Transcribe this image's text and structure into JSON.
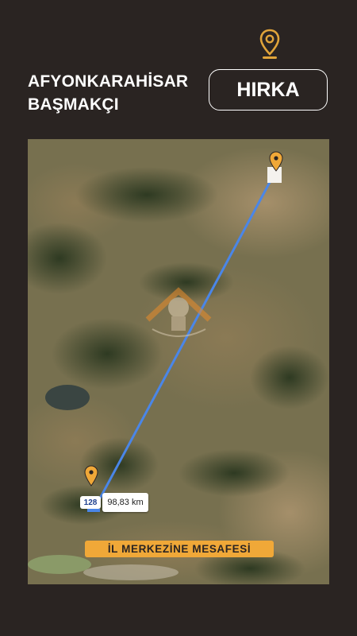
{
  "header": {
    "province": "AFYONKARAHİSAR",
    "district": "BAŞMAKÇI",
    "village": "HIRKA",
    "pin_icon": "map-pin-icon"
  },
  "map": {
    "distance_label": "98,83 km",
    "road_number": "128",
    "banner_text": "İL MERKEZİNE MESAFESİ",
    "destination_marker_icon": "map-pin-icon",
    "origin_marker_icon": "map-pin-icon",
    "watermark_icon": "watermark-logo-icon"
  },
  "colors": {
    "background": "#2a2422",
    "accent": "#f0a838",
    "route": "#4a86e8",
    "text": "#ffffff"
  }
}
